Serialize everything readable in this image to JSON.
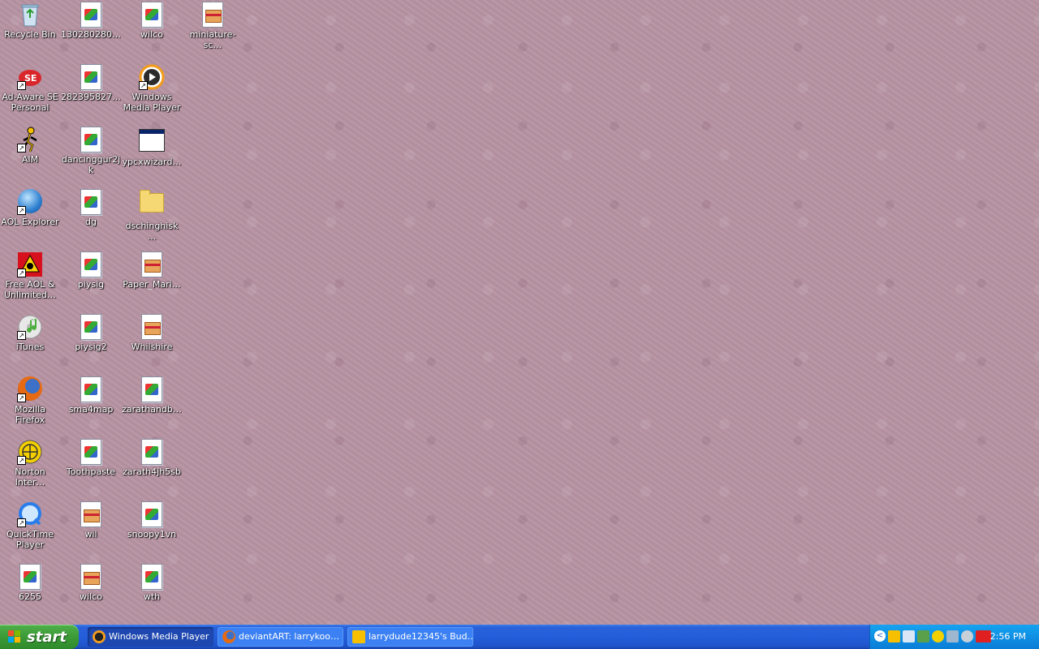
{
  "desktop": {
    "icons": [
      {
        "label": "Recycle Bin",
        "type": "recycle-bin"
      },
      {
        "label": "Ad-Aware SE Personal",
        "type": "adaware"
      },
      {
        "label": "AIM",
        "type": "aim"
      },
      {
        "label": "AOL Explorer",
        "type": "aol-explorer"
      },
      {
        "label": "Free AOL & Unlimited…",
        "type": "free-aol"
      },
      {
        "label": "iTunes",
        "type": "itunes"
      },
      {
        "label": "Mozilla Firefox",
        "type": "firefox"
      },
      {
        "label": "Norton Inter…",
        "type": "norton"
      },
      {
        "label": "QuickTime Player",
        "type": "quicktime"
      },
      {
        "label": "6255",
        "type": "image-file"
      },
      {
        "label": "130280280…",
        "type": "image-file"
      },
      {
        "label": "282395827…",
        "type": "image-file"
      },
      {
        "label": "dancinggur2jk",
        "type": "image-file"
      },
      {
        "label": "dg",
        "type": "image-file"
      },
      {
        "label": "piysig",
        "type": "image-file"
      },
      {
        "label": "piysig2",
        "type": "image-file"
      },
      {
        "label": "sma4map",
        "type": "image-file"
      },
      {
        "label": "Toothpaste",
        "type": "image-file"
      },
      {
        "label": "wil",
        "type": "archive-file"
      },
      {
        "label": "wilco",
        "type": "archive-file"
      },
      {
        "label": "wilco",
        "type": "image-file"
      },
      {
        "label": "Windows Media Player",
        "type": "wmp"
      },
      {
        "label": "ypcxwizard…",
        "type": "window-app"
      },
      {
        "label": "dschinghisk…",
        "type": "folder"
      },
      {
        "label": "Paper_Mari…",
        "type": "archive-file"
      },
      {
        "label": "Whilshire",
        "type": "archive-file"
      },
      {
        "label": "zarathandb…",
        "type": "image-file"
      },
      {
        "label": "zarath4jh5sb",
        "type": "image-file"
      },
      {
        "label": "snoopy1vn",
        "type": "image-file"
      },
      {
        "label": "wth",
        "type": "image-file"
      },
      {
        "label": "miniature-sc…",
        "type": "archive-file"
      }
    ]
  },
  "taskbar": {
    "start_label": "start",
    "tasks": [
      {
        "label": "Windows Media Player",
        "state": "active",
        "icon": "wmp-icon"
      },
      {
        "label": "deviantART: larrykoo…",
        "state": "inactive",
        "icon": "firefox-icon"
      },
      {
        "label": "larrydude12345's Bud…",
        "state": "inactive",
        "icon": "aim-icon"
      }
    ],
    "tray": {
      "expand_label": "<",
      "icons": [
        "aim-tray-icon",
        "network-tray-icon",
        "tray-icon-3",
        "norton-tray-icon",
        "display-tray-icon",
        "tray-icon-6",
        "ati-tray-icon"
      ],
      "clock": "2:56 PM"
    }
  },
  "colors": {
    "wallpaper": "#b894a3",
    "taskbar": "#245edb",
    "start_button": "#3c9a37",
    "tray": "#0f8fe3"
  }
}
